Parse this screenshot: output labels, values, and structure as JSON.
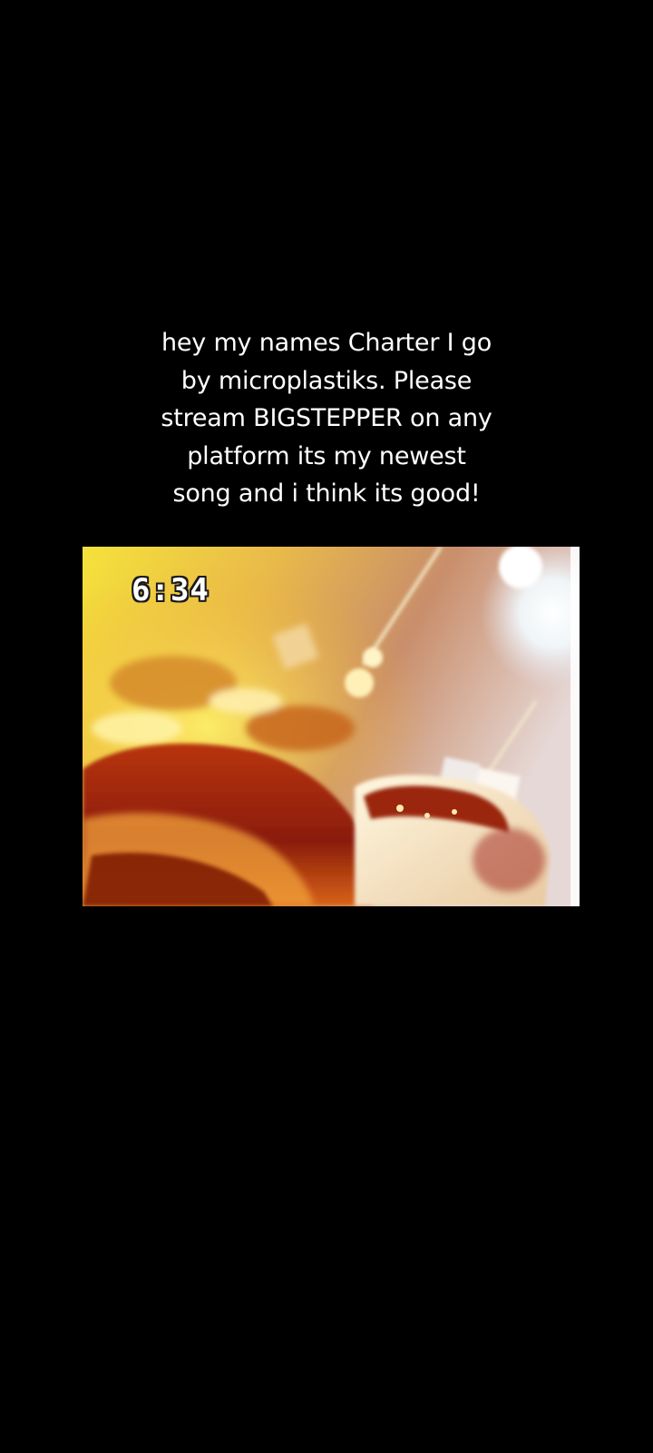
{
  "caption": {
    "lines": [
      "hey my names Charter I go",
      "by microplastiks. Please",
      "stream BIGSTEPPER on any",
      "platform its my newest",
      "song and i think its good!"
    ]
  },
  "video": {
    "timestamp": "6:34"
  },
  "colors": {
    "background": "#000000",
    "caption_text": "#ffffff"
  }
}
